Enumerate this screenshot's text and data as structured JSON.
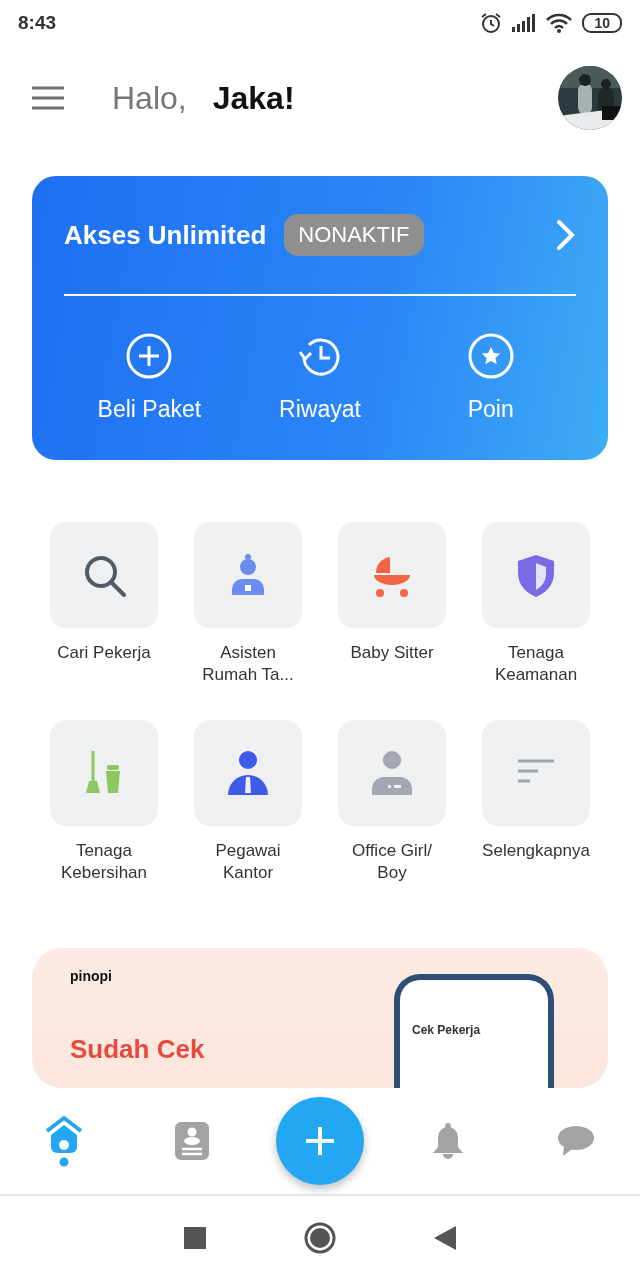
{
  "status_bar": {
    "time": "8:43",
    "battery": "10"
  },
  "header": {
    "greeting": "Halo,",
    "name": "Jaka!"
  },
  "membership": {
    "title": "Akses Unlimited",
    "status": "NONAKTIF",
    "active": false,
    "actions": [
      {
        "label": "Beli Paket",
        "kind": "plus"
      },
      {
        "label": "Riwayat",
        "kind": "history"
      },
      {
        "label": "Poin",
        "kind": "star"
      }
    ]
  },
  "services": [
    {
      "label": "Cari Pekerja",
      "kind": "search",
      "color": "#4f5b66"
    },
    {
      "label": "Asisten Rumah Ta...",
      "kind": "maid",
      "color": "#6a8ef0"
    },
    {
      "label": "Baby Sitter",
      "kind": "stroller",
      "color": "#f26545"
    },
    {
      "label": "Tenaga Keamanan",
      "kind": "shield",
      "color": "#7a6ae6"
    },
    {
      "label": "Tenaga Kebersihan",
      "kind": "broom",
      "color": "#8cc862"
    },
    {
      "label": "Pegawai Kantor",
      "kind": "worker",
      "color": "#3f5be8"
    },
    {
      "label": "Office Girl/ Boy",
      "kind": "office",
      "color": "#a2a7b0"
    },
    {
      "label": "Selengkapnya",
      "kind": "more",
      "color": "#a0a4a8"
    }
  ],
  "promo": {
    "brand": "pinopi",
    "headline": "Sudah Cek",
    "phone_title": "Cek Pekerja"
  },
  "bottom_nav": [
    {
      "kind": "home",
      "selected": true
    },
    {
      "kind": "contacts",
      "selected": false
    },
    {
      "kind": "bell",
      "selected": false
    },
    {
      "kind": "chat",
      "selected": false
    }
  ]
}
